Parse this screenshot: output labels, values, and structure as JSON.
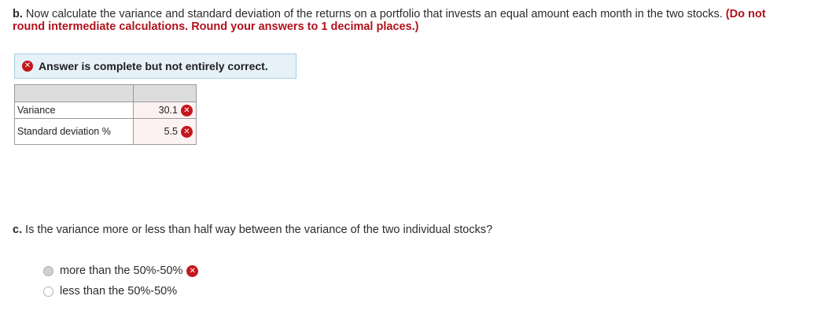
{
  "question_b": {
    "part_label": "b.",
    "text": "Now calculate the variance and standard deviation of the  returns on a portfolio that invests an equal amount each month in the two stocks.",
    "instruction": "(Do not round intermediate calculations. Round your answers to 1 decimal places.)"
  },
  "status": {
    "icon": "error-x-icon",
    "text": "Answer is complete but not entirely correct."
  },
  "answer_table": {
    "rows": [
      {
        "label": "Variance",
        "value": "30.1",
        "correct": false
      },
      {
        "label": "Standard deviation %",
        "value": "5.5",
        "correct": false
      }
    ]
  },
  "question_c": {
    "part_label": "c.",
    "text": "Is the variance more or less than half way between the variance of the two individual stocks?"
  },
  "options": [
    {
      "label": "more than the 50%-50%",
      "selected": true,
      "correct": false
    },
    {
      "label": "less than the 50%-50%",
      "selected": false
    }
  ],
  "colors": {
    "error_red": "#c4161c",
    "instruction_red": "#b1121d",
    "status_bg": "#e6f1f8",
    "status_border": "#a9cfe6",
    "answer_cell_bg": "#fdf2f2",
    "table_header_bg": "#dcdcdc"
  }
}
